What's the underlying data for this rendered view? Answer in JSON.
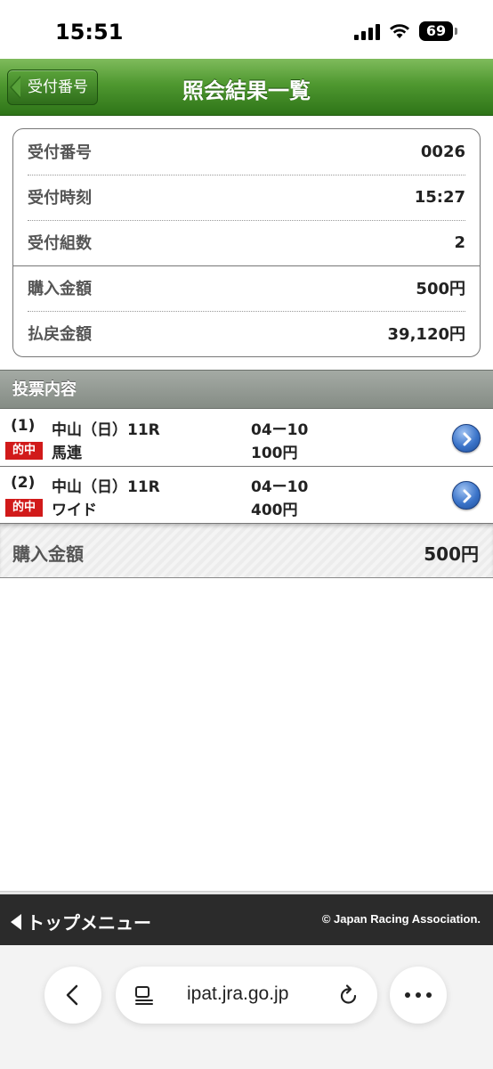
{
  "status_bar": {
    "time": "15:51",
    "battery": "69"
  },
  "header": {
    "back_label": "受付番号",
    "title": "照会結果一覧"
  },
  "receipt": {
    "rows": [
      {
        "label": "受付番号",
        "value": "0026"
      },
      {
        "label": "受付時刻",
        "value": "15:27"
      },
      {
        "label": "受付組数",
        "value": "2"
      },
      {
        "label": "購入金額",
        "value": "500円"
      },
      {
        "label": "払戻金額",
        "value": "39,120円"
      }
    ]
  },
  "section": {
    "title": "投票内容"
  },
  "bets": [
    {
      "num": "(1)",
      "race": "中山（日）11R",
      "combo": "04ー10",
      "badge": "的中",
      "type": "馬連",
      "amount": "100円"
    },
    {
      "num": "(2)",
      "race": "中山（日）11R",
      "combo": "04ー10",
      "badge": "的中",
      "type": "ワイド",
      "amount": "400円"
    }
  ],
  "total": {
    "label": "購入金額",
    "value": "500円"
  },
  "footer": {
    "top_menu": "トップメニュー",
    "copyright": "© Japan Racing Association."
  },
  "browser": {
    "url": "ipat.jra.go.jp"
  },
  "colors": {
    "header_green": "#4f9830",
    "hit_red": "#d11a1a",
    "chevron_blue": "#3b74c9",
    "footer_dark": "#2b2b2b"
  }
}
